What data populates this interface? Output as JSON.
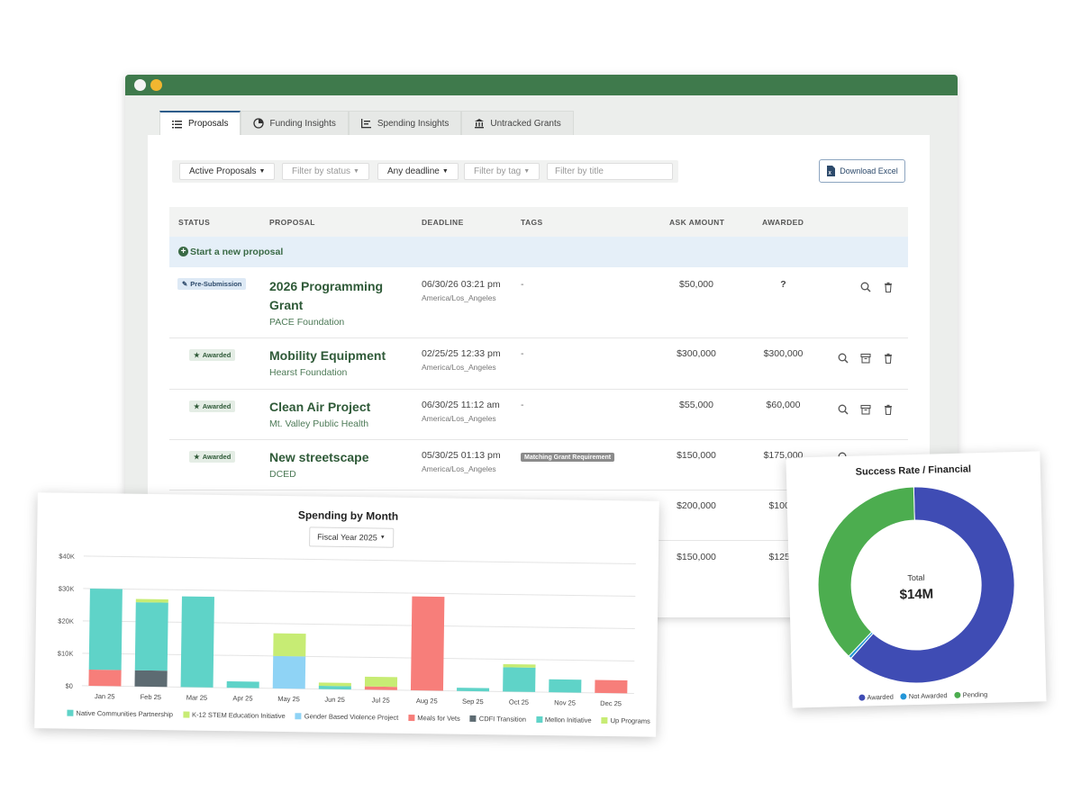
{
  "tabs": [
    {
      "label": "Proposals",
      "icon": "list-icon",
      "active": true
    },
    {
      "label": "Funding Insights",
      "icon": "pie-chart-icon"
    },
    {
      "label": "Spending Insights",
      "icon": "bar-chart-icon"
    },
    {
      "label": "Untracked Grants",
      "icon": "bank-icon"
    }
  ],
  "filters": {
    "active_proposals": "Active Proposals",
    "status_placeholder": "Filter by status",
    "deadline": "Any deadline",
    "tag_placeholder": "Filter by tag",
    "title_placeholder": "Filter by title",
    "download_label": "Download Excel"
  },
  "table": {
    "headers": {
      "status": "STATUS",
      "proposal": "PROPOSAL",
      "deadline": "DEADLINE",
      "tags": "TAGS",
      "ask": "ASK AMOUNT",
      "awarded": "AWARDED"
    },
    "new_proposal_label": "Start a new proposal",
    "rows": [
      {
        "status": "Pre-Submission",
        "name_line1": "2026 Programming",
        "name_line2": "Grant",
        "funder": "PACE Foundation",
        "deadline": "06/30/26 03:21 pm",
        "tz": "America/Los_Angeles",
        "tags": "-",
        "ask": "$50,000",
        "awarded": "?"
      },
      {
        "status": "Awarded",
        "name_line1": "Mobility Equipment",
        "funder": "Hearst Foundation",
        "deadline": "02/25/25 12:33 pm",
        "tz": "America/Los_Angeles",
        "tags": "-",
        "ask": "$300,000",
        "awarded": "$300,000"
      },
      {
        "status": "Awarded",
        "name_line1": "Clean Air Project",
        "funder": "Mt. Valley Public Health",
        "deadline": "06/30/25 11:12 am",
        "tz": "America/Los_Angeles",
        "tags": "-",
        "ask": "$55,000",
        "awarded": "$60,000"
      },
      {
        "status": "Awarded",
        "name_line1": "New streetscape",
        "funder": "DCED",
        "deadline": "05/30/25 01:13 pm",
        "tz": "America/Los_Angeles",
        "tag_chip": "Matching Grant Requirement",
        "ask": "$150,000",
        "awarded": "$175,000"
      },
      {
        "ask": "$200,000",
        "awarded": "$100,0"
      },
      {
        "ask": "$150,000",
        "awarded": "$125,0"
      }
    ]
  },
  "spending": {
    "title": "Spending by Month",
    "fiscal_year": "Fiscal Year 2025",
    "legend": [
      {
        "name": "Native Communities Partnership",
        "color": "#5fd3c8"
      },
      {
        "name": "K-12 STEM Education Initiative",
        "color": "#c7ec74"
      },
      {
        "name": "Gender Based Violence Project",
        "color": "#8fd3f5"
      },
      {
        "name": "Meals for Vets",
        "color": "#f77e7a"
      },
      {
        "name": "CDFI Transition",
        "color": "#5d6b72"
      },
      {
        "name": "Mellon Initiative",
        "color": "#5fd3c8"
      },
      {
        "name": "Up Programs",
        "color": "#c7ec74"
      }
    ]
  },
  "chart_data": [
    {
      "type": "bar",
      "title": "Spending by Month",
      "categories": [
        "Jan 25",
        "Feb 25",
        "Mar 25",
        "Apr 25",
        "May 25",
        "Jun 25",
        "Jul 25",
        "Aug 25",
        "Sep 25",
        "Oct 25",
        "Nov 25",
        "Dec 25"
      ],
      "ylim": [
        0,
        40000
      ],
      "yticks": [
        "$0",
        "$10K",
        "$20K",
        "$30K",
        "$40K"
      ],
      "stacked": true,
      "series": [
        {
          "name": "Meals for Vets",
          "color": "#f77e7a",
          "values": [
            5000,
            0,
            0,
            0,
            0,
            0,
            1000,
            29000,
            0,
            0,
            0,
            4000
          ]
        },
        {
          "name": "CDFI Transition",
          "color": "#5d6b72",
          "values": [
            0,
            5000,
            0,
            0,
            0,
            0,
            0,
            0,
            0,
            0,
            0,
            0
          ]
        },
        {
          "name": "Native Communities Partnership",
          "color": "#5fd3c8",
          "values": [
            25000,
            21000,
            28000,
            2000,
            0,
            1000,
            0,
            0,
            1000,
            7500,
            4000,
            0
          ]
        },
        {
          "name": "Gender Based Violence Project",
          "color": "#8fd3f5",
          "values": [
            0,
            0,
            0,
            0,
            10000,
            0,
            0,
            0,
            0,
            0,
            0,
            0
          ]
        },
        {
          "name": "K-12 STEM Education Initiative",
          "color": "#c7ec74",
          "values": [
            0,
            1000,
            0,
            0,
            7000,
            1000,
            3000,
            0,
            0,
            1000,
            0,
            0
          ]
        }
      ]
    },
    {
      "type": "pie",
      "title": "Success Rate / Financial",
      "center_label": "Total",
      "center_value": "$14M",
      "series": [
        {
          "name": "Awarded",
          "color": "#3f4cb4",
          "value": 62
        },
        {
          "name": "Not Awarded",
          "color": "#2496d8",
          "value": 0.5
        },
        {
          "name": "Pending",
          "color": "#4cad4f",
          "value": 37.5
        }
      ]
    }
  ]
}
